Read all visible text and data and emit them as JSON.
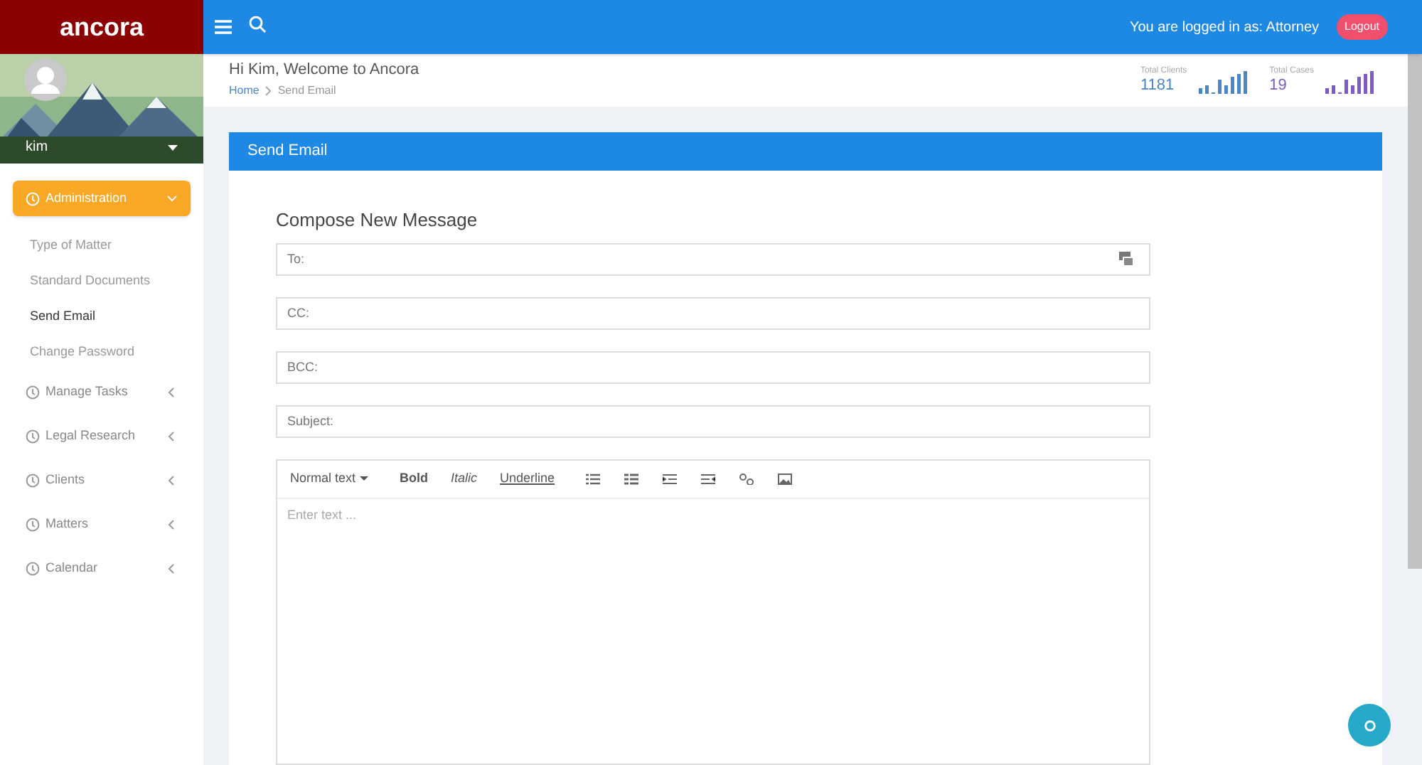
{
  "brand": "ancora",
  "user": {
    "name": "kim"
  },
  "sidebar": {
    "items": [
      {
        "label": "Administration",
        "selected": true,
        "expanded": true,
        "children": [
          {
            "label": "Type of Matter",
            "selected": false
          },
          {
            "label": "Standard Documents",
            "selected": false
          },
          {
            "label": "Send Email",
            "selected": true
          },
          {
            "label": "Change Password",
            "selected": false
          }
        ]
      },
      {
        "label": "Manage Tasks",
        "selected": false,
        "expanded": false
      },
      {
        "label": "Legal Research",
        "selected": false,
        "expanded": false
      },
      {
        "label": "Clients",
        "selected": false,
        "expanded": false
      },
      {
        "label": "Matters",
        "selected": false,
        "expanded": false
      },
      {
        "label": "Calendar",
        "selected": false,
        "expanded": false
      }
    ]
  },
  "header": {
    "login_text": "You are logged in as: Attorney",
    "logout": "Logout"
  },
  "page": {
    "title": "Hi Kim, Welcome to Ancora",
    "breadcrumb": [
      "Home",
      "Send Email"
    ]
  },
  "stats": [
    {
      "label": "Total Clients",
      "value": "1181",
      "color": "#4a86c8"
    },
    {
      "label": "Total Cases",
      "value": "19",
      "color": "#7e5bc7"
    }
  ],
  "card": {
    "title": "Send Email",
    "heading": "Compose New Message",
    "fields": [
      {
        "placeholder": "To:",
        "kind": "contacts"
      },
      {
        "placeholder": "CC:",
        "kind": "plain"
      },
      {
        "placeholder": "BCC:",
        "kind": "plain"
      },
      {
        "placeholder": "Subject:",
        "kind": "plain"
      }
    ],
    "editor": {
      "format": "Normal text",
      "styles": [
        {
          "label": "Bold",
          "kind": "bold"
        },
        {
          "label": "Italic",
          "kind": "italic"
        },
        {
          "label": "Underline",
          "kind": "underline"
        }
      ],
      "placeholder": "Enter text ..."
    }
  }
}
